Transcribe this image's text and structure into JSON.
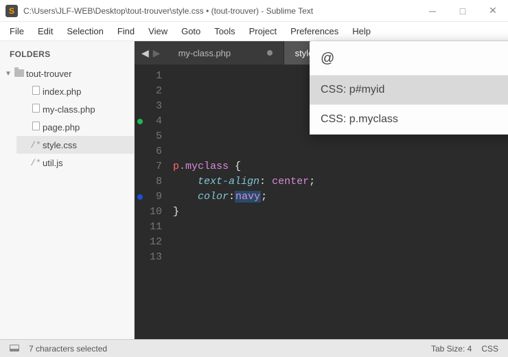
{
  "window": {
    "title": "C:\\Users\\JLF-WEB\\Desktop\\tout-trouver\\style.css • (tout-trouver) - Sublime Text",
    "icon_letter": "S"
  },
  "menu": [
    "File",
    "Edit",
    "Selection",
    "Find",
    "View",
    "Goto",
    "Tools",
    "Project",
    "Preferences",
    "Help"
  ],
  "sidebar": {
    "heading": "FOLDERS",
    "root": "tout-trouver",
    "files": [
      {
        "name": "index.php",
        "kind": "file",
        "selected": false
      },
      {
        "name": "my-class.php",
        "kind": "file",
        "selected": false
      },
      {
        "name": "page.php",
        "kind": "file",
        "selected": false
      },
      {
        "name": "style.css",
        "kind": "code",
        "selected": true
      },
      {
        "name": "util.js",
        "kind": "code",
        "selected": false
      }
    ]
  },
  "tabs": [
    {
      "label": "my-class.php",
      "active": false,
      "dirty": true
    },
    {
      "label": "style.css",
      "active": true,
      "dirty": true
    }
  ],
  "gutter": {
    "lines": [
      "1",
      "2",
      "3",
      "4",
      "5",
      "6",
      "7",
      "8",
      "9",
      "10",
      "11",
      "12",
      "13"
    ],
    "marks": {
      "4": "green",
      "9": "blue"
    }
  },
  "code": {
    "l7_sel": "p",
    "l7_cls": ".myclass",
    "l7_brace": " {",
    "l8_prop": "text-align",
    "l8_val": "center",
    "l9_prop": "color",
    "l9_val": "navy",
    "l10_brace": "}",
    "colon": ":",
    "semi": ";",
    "indent1": "    "
  },
  "popup": {
    "query": "@",
    "options": [
      {
        "label": "CSS: p#myid",
        "selected": true
      },
      {
        "label": "CSS: p.myclass",
        "selected": false
      }
    ]
  },
  "status": {
    "selection": "7 characters selected",
    "tabsize": "Tab Size: 4",
    "syntax": "CSS"
  }
}
